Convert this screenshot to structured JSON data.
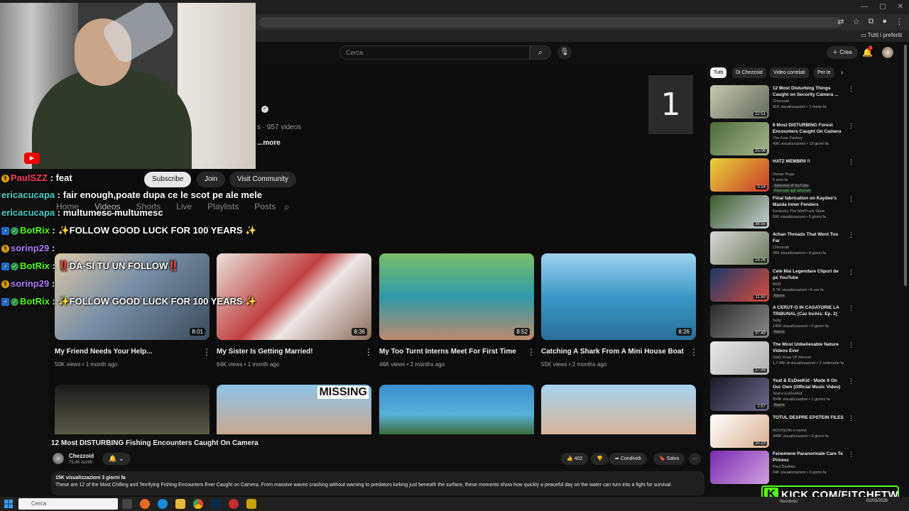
{
  "browser": {
    "bookmarks_label": "Tutti i preferiti"
  },
  "header": {
    "search_placeholder": "Cerca",
    "create_label": "Crea",
    "notification_count": "3"
  },
  "channel": {
    "counter": "1",
    "meta": "s · 957 videos",
    "more": "...more",
    "subscribe": "Subscribe",
    "join": "Join",
    "visit_community": "Visit Community",
    "tabs": [
      "Home",
      "Videos",
      "Shorts",
      "Live",
      "Playlists",
      "Posts"
    ]
  },
  "videos": [
    {
      "title": "My Friend Needs Your Help...",
      "meta": "50K views • 1 month ago",
      "duration": "8:01"
    },
    {
      "title": "My Sister Is Getting Married!",
      "meta": "64K views • 1 month ago",
      "duration": "8:36"
    },
    {
      "title": "My Too Turnt Interns Meet For First Time",
      "meta": "46K views • 2 months ago",
      "duration": "8:52"
    },
    {
      "title": "Catching A Shark From A Mini House Boat",
      "meta": "55K views • 2 months ago",
      "duration": "8:26"
    }
  ],
  "row2_labels": {
    "missing": "MISSING"
  },
  "watch": {
    "title": "12 Most DISTURBING Fishing Encounters Caught On Camera",
    "owner": "Chezzoid",
    "subs": "75,4K iscritti",
    "likes": "402",
    "share": "Condividi",
    "save": "Salva",
    "stats": "15K visualizzazioni  3 giorni fa",
    "description": "These are 12 of the Most Chilling and Terrifying Fishing Encounters Ever Caught on Camera. From massive waves crashing without warning to predators lurking just beneath the surface, these moments show how quickly a peaceful day on the water can turn into a fight for survival."
  },
  "sidebar": {
    "chips": [
      "Tutti",
      "Di Chezzoid",
      "Video correlati",
      "Per te"
    ],
    "items": [
      {
        "title": "12 Most Disturbing Things Caught on Security Camera ...",
        "channel": "Chezzoid",
        "views": "91K visualizzazioni • 1 mese fa",
        "duration": "22:51",
        "badge": ""
      },
      {
        "title": "6 Most DISTURBING Forest Encounters Caught On Camera",
        "channel": "The Fear Factory",
        "views": "49K visualizzazioni • 13 giorni fa",
        "duration": "25:06",
        "badge": ""
      },
      {
        "title": "HATZ MEMBRII !!",
        "channel": "Dorian Popa",
        "views": "5 anni fa",
        "duration": "0:14",
        "badge": "Selezione di YouTube",
        "badge2": "Riservato agli abbonati"
      },
      {
        "title": "Final fabrication on Kaydee's Mazda Inner Fenders",
        "channel": "Kentucky The MiniTruck State",
        "views": "596 visualizzazioni • 8 giorni fa",
        "duration": "38:55",
        "badge": ""
      },
      {
        "title": "4chan Threads That Went Too Far",
        "channel": "Chezzoid",
        "views": "389 visualizzazioni • 8 giorni fa",
        "duration": "18:26",
        "badge": ""
      },
      {
        "title": "Cele Mai Legendare Clipuri de pe YouTube",
        "channel": "BDR",
        "views": "6,7K visualizzazioni • 6 ore fa",
        "duration": "11:50",
        "badge": "Nuovo"
      },
      {
        "title": "A CERUT-O IN CASATORIE LA TRIBUNAL (Caz Inchis: Ep. 2)",
        "channel": "Selly",
        "views": "145K visualizzazioni • 5 giorni fa",
        "duration": "37:49",
        "badge": "Nuovo"
      },
      {
        "title": "The Most Unbelievable Nature Videos Ever",
        "channel": "Daily Dose Of Internet",
        "views": "1,7 Mln di visualizzazioni • 2 settimane fa",
        "duration": "27:49",
        "badge": ""
      },
      {
        "title": "Yeat & EsDeeKid - Made It On Our Own (Official Music Video)",
        "channel": "Yeat e EsDeeKid",
        "views": "694K visualizzazioni • 1 giorno fa",
        "duration": "2:57",
        "badge": "Nuovo"
      },
      {
        "title": "TOTUL DESPRE EPSTEIN FILES",
        "channel": "ROVISION e rovion",
        "views": "346K visualizzazioni • 3 giorni fa",
        "duration": "20:23",
        "badge": ""
      },
      {
        "title": "Fenomene Paranormale Care Te Privesc",
        "channel": "Paul Dadrian",
        "views": "34K visualizzazioni • 6 giorni fa",
        "duration": "",
        "badge": ""
      }
    ]
  },
  "chat": [
    {
      "user": "PaulSZZ",
      "msg": ": feat",
      "color": "#ff3b5c"
    },
    {
      "user": "ericacucapa",
      "msg": ": fair enough,poate dupa ce le scot pe ale mele",
      "color": "#4dd0c8"
    },
    {
      "user": "ericacucapa",
      "msg": ": multumesc multumesc",
      "color": "#4dd0c8"
    },
    {
      "user": "BotRix",
      "msg": ": ✨FOLLOW GOOD LUCK FOR 100 YEARS ✨",
      "color": "#53fc18"
    },
    {
      "user": "sorinp29",
      "msg": ":",
      "color": "#b07cff"
    },
    {
      "user": "BotRix",
      "msg": ": ‼️DA-SI TU UN FOLLOW‼️",
      "color": "#53fc18"
    },
    {
      "user": "sorinp29",
      "msg": ":",
      "color": "#b07cff"
    },
    {
      "user": "BotRix",
      "msg": ": ✨FOLLOW GOOD LUCK FOR 100 YEARS ✨",
      "color": "#53fc18"
    }
  ],
  "watermark": {
    "kick_text": "KICK.COM/FITCHFTW"
  },
  "taskbar": {
    "search": "Cerca",
    "weather": "Nuvoloso",
    "date": "01/03/2026"
  },
  "colors": {
    "youtube_bg": "#0f0f0f",
    "kick_green": "#53fc18",
    "youtube_red": "#e00000"
  }
}
